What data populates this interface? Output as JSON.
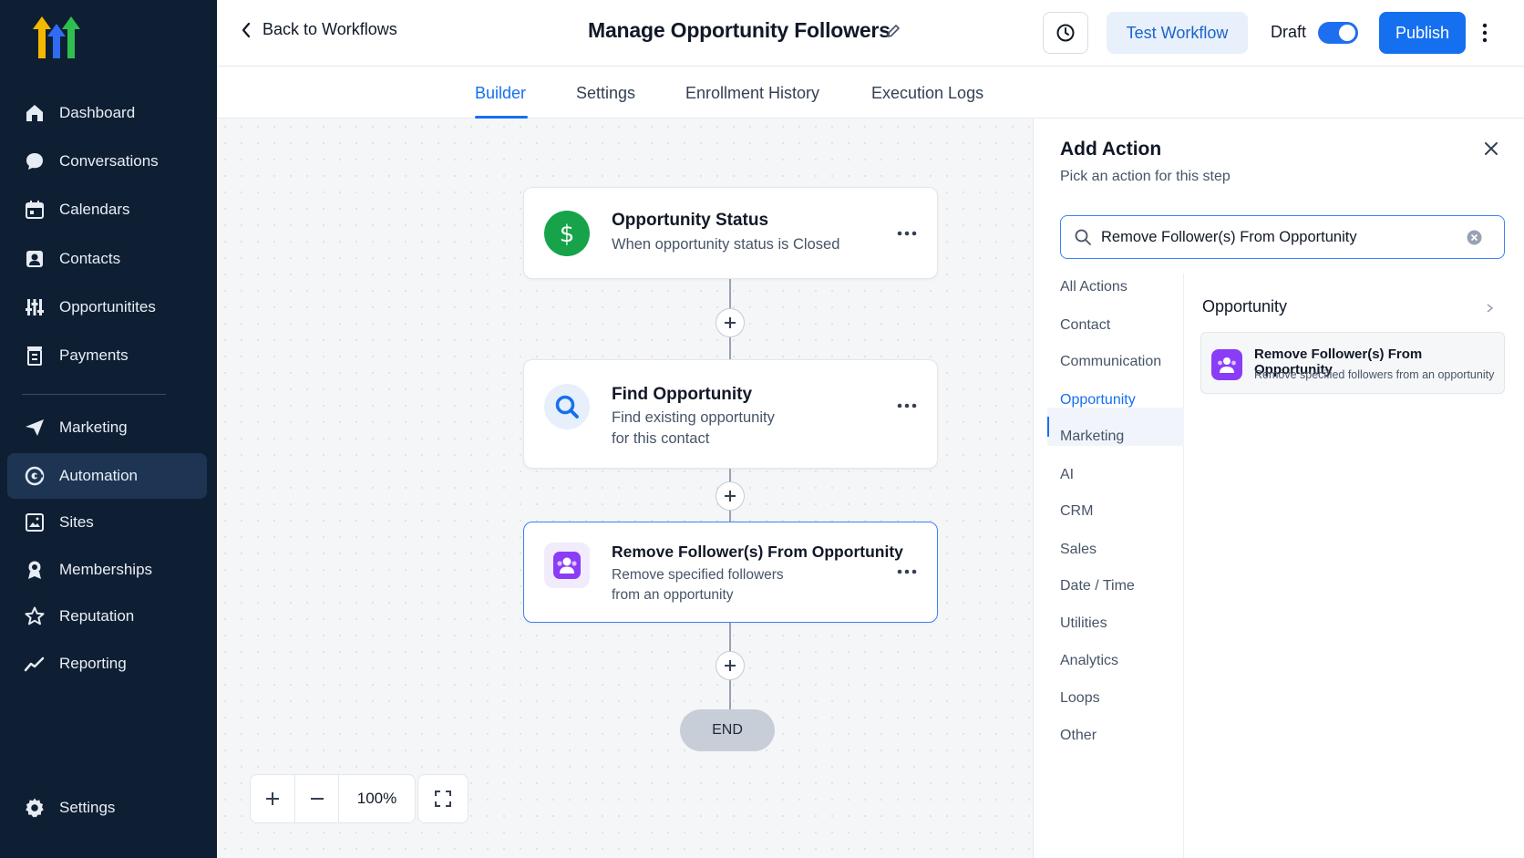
{
  "sidebar": {
    "items": [
      {
        "label": "Dashboard",
        "icon": "home-icon"
      },
      {
        "label": "Conversations",
        "icon": "chat-icon"
      },
      {
        "label": "Calendars",
        "icon": "calendar-icon"
      },
      {
        "label": "Contacts",
        "icon": "contacts-icon"
      },
      {
        "label": "Opportunitites",
        "icon": "filter-icon"
      },
      {
        "label": "Payments",
        "icon": "payments-icon"
      },
      {
        "label": "Marketing",
        "icon": "send-icon"
      },
      {
        "label": "Automation",
        "icon": "automation-icon"
      },
      {
        "label": "Sites",
        "icon": "sites-icon"
      },
      {
        "label": "Memberships",
        "icon": "award-icon"
      },
      {
        "label": "Reputation",
        "icon": "star-icon"
      },
      {
        "label": "Reporting",
        "icon": "chart-line-icon"
      }
    ],
    "active": "Automation",
    "settings_label": "Settings"
  },
  "header": {
    "back_label": "Back to Workflows",
    "title": "Manage Opportunity Followers",
    "test_label": "Test Workflow",
    "draft_label": "Draft",
    "draft_enabled": true,
    "publish_label": "Publish"
  },
  "tabs": [
    "Builder",
    "Settings",
    "Enrollment History",
    "Execution Logs"
  ],
  "active_tab": "Builder",
  "workflow": {
    "nodes": [
      {
        "title": "Opportunity Status",
        "desc": "When opportunity status is Closed",
        "icon": "dollar-icon",
        "color": "#16a34a"
      },
      {
        "title": "Find Opportunity",
        "desc_lines": [
          "Find existing opportunity",
          "for this contact"
        ],
        "icon": "search-icon",
        "color": "#1570ef"
      },
      {
        "title": "Remove Follower(s) From Opportunity",
        "desc_lines": [
          "Remove specified followers",
          "from an opportunity"
        ],
        "icon": "remove-followers-icon",
        "color": "#8b3cf7"
      }
    ],
    "end_label": "END",
    "zoom": "100%"
  },
  "panel": {
    "title": "Add Action",
    "subtitle": "Pick an action for this step",
    "search_value": "Remove Follower(s) From Opportunity",
    "categories": [
      "All Actions",
      "Contact",
      "Communication",
      "Opportunity",
      "Marketing",
      "AI",
      "CRM",
      "Sales",
      "Date / Time",
      "Utilities",
      "Analytics",
      "Loops",
      "Other"
    ],
    "active_category": "Opportunity",
    "result_group": "Opportunity",
    "result": {
      "title": "Remove Follower(s) From Opportunity",
      "desc": "Remove specified followers from an opportunity"
    }
  }
}
